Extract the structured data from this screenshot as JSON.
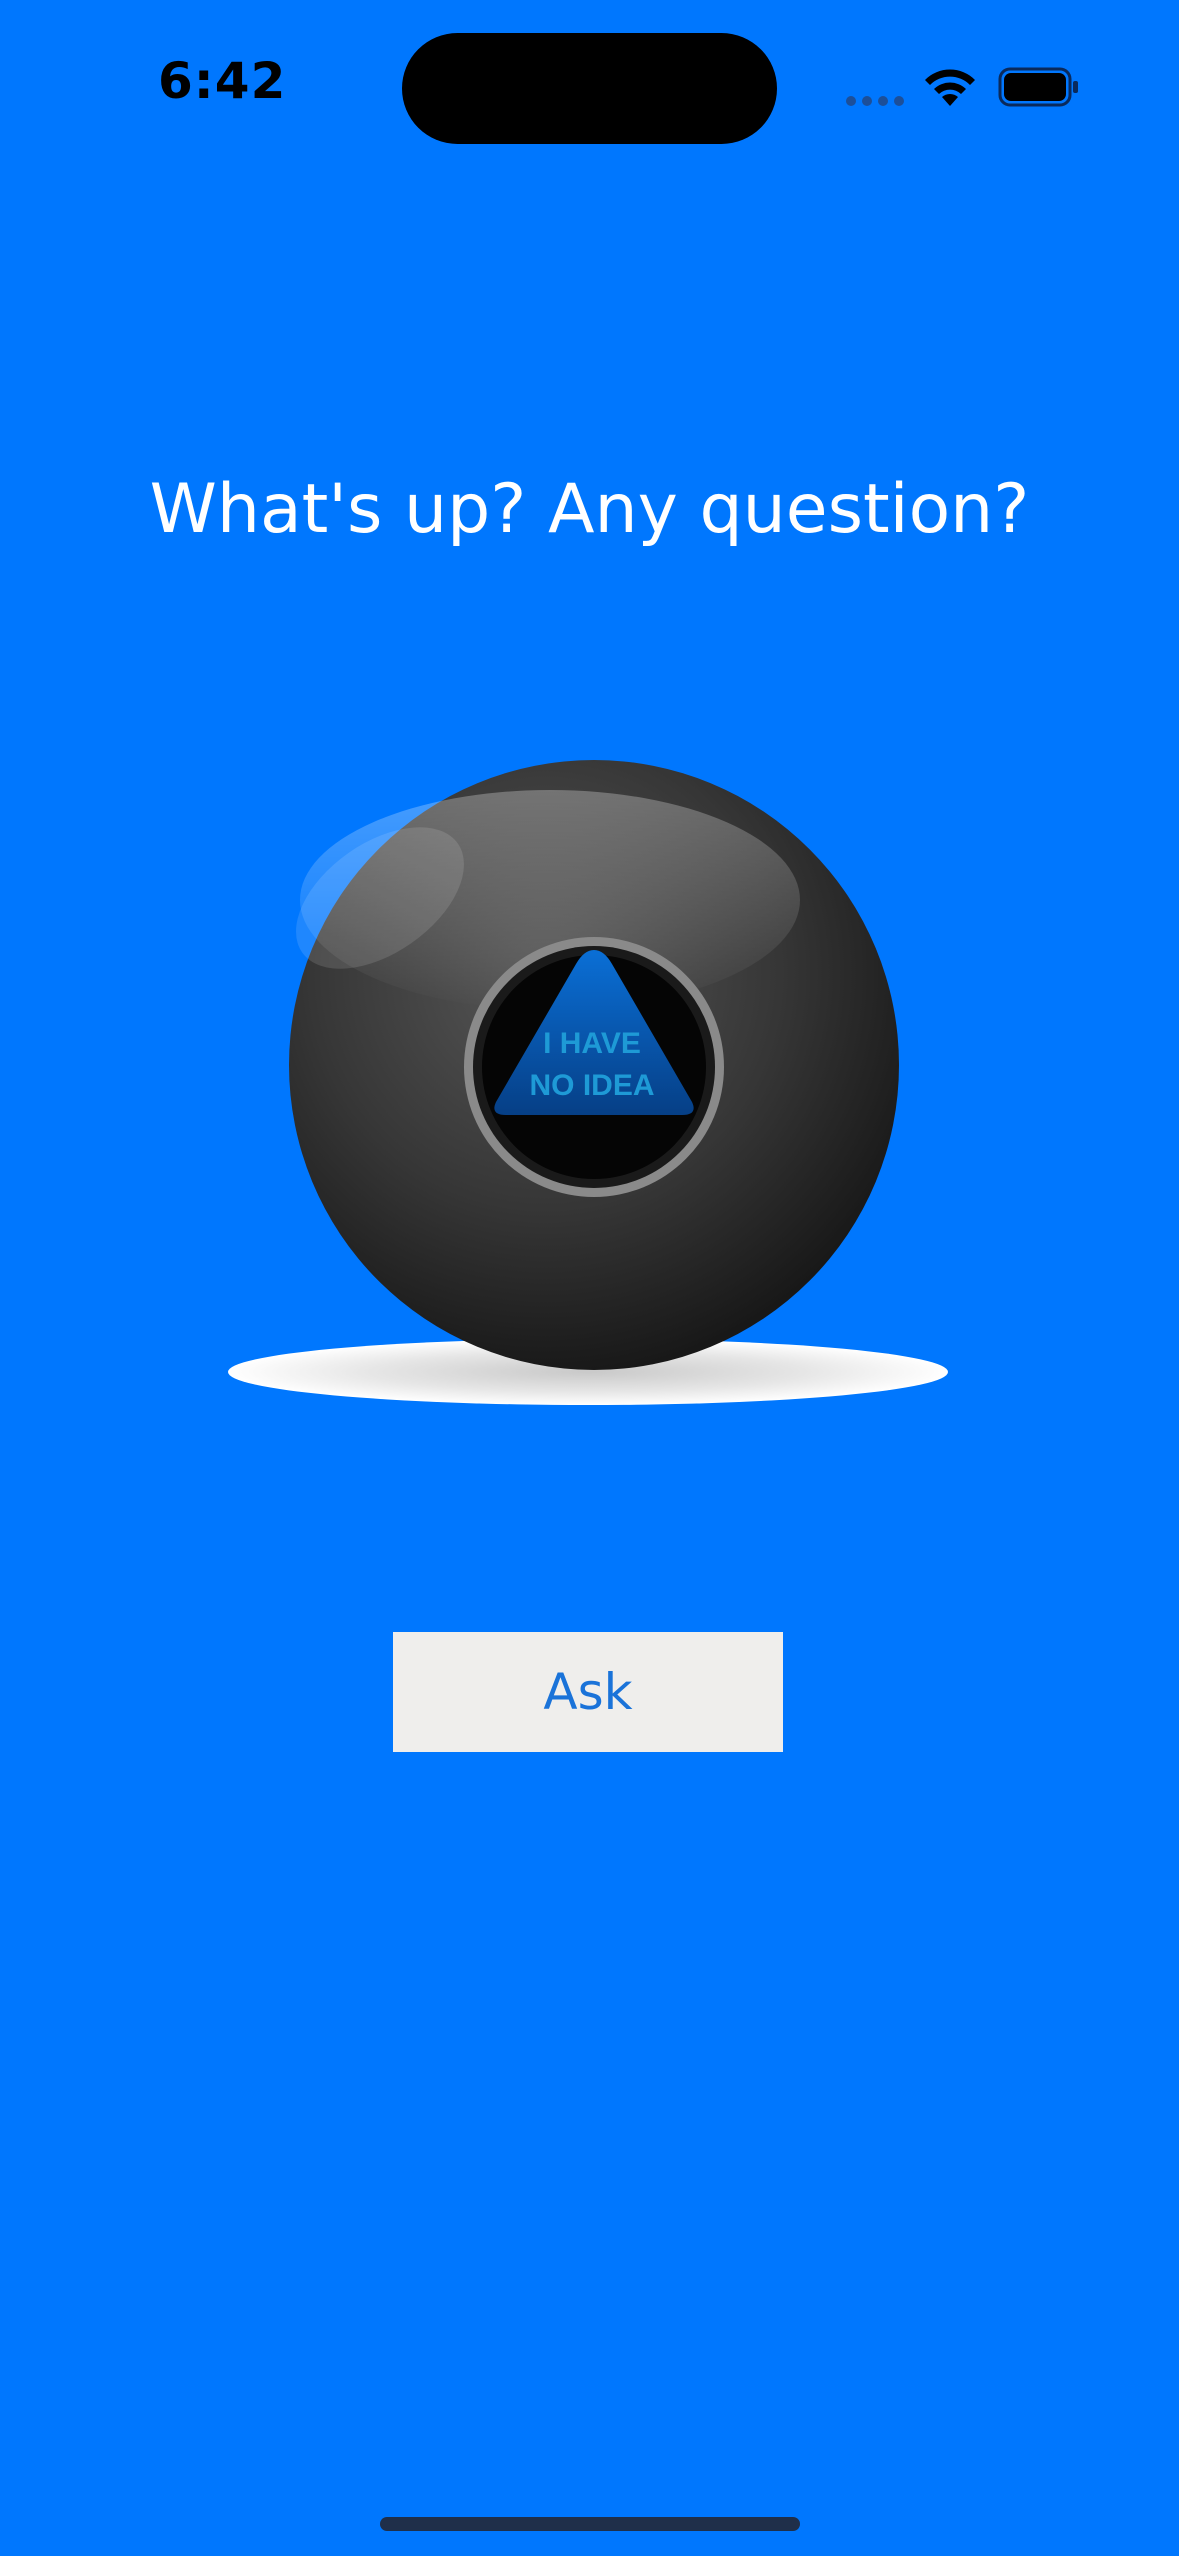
{
  "status_bar": {
    "time": "6:42",
    "wifi_icon": "wifi-icon",
    "battery_icon": "battery-icon",
    "signal_icon": "cellular-signal-icon"
  },
  "main": {
    "headline": "What's up? Any question?",
    "ball": {
      "answer_line1": "I HAVE",
      "answer_line2": "NO IDEA"
    },
    "ask_button_label": "Ask"
  },
  "colors": {
    "background": "#0077fe",
    "button_background": "#efeeec",
    "button_text": "#1a73d9",
    "answer_text": "#1e9ad6"
  }
}
